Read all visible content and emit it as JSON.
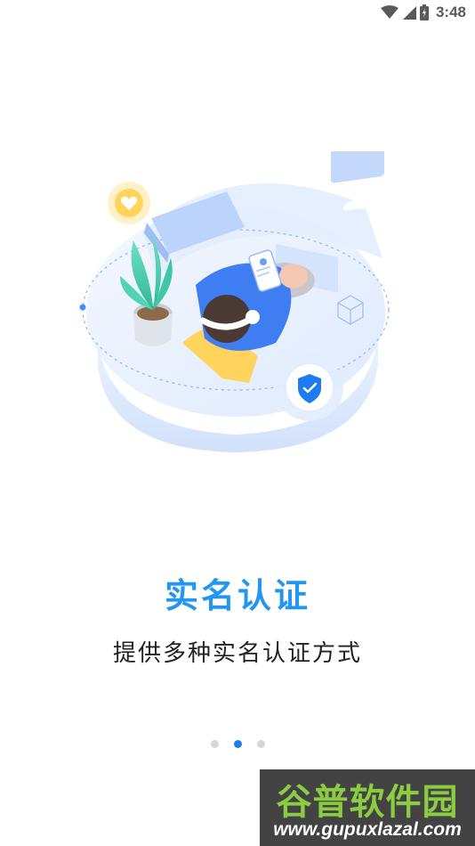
{
  "status_bar": {
    "time": "3:48",
    "icons": [
      "wifi-icon",
      "cell-signal-icon",
      "battery-icon"
    ]
  },
  "onboarding": {
    "illustration": "identity-verification-illustration",
    "title": "实名认证",
    "subtitle": "提供多种实名认证方式",
    "page_indicator": {
      "total": 3,
      "current": 2
    }
  },
  "watermark": {
    "main": "谷普软件园",
    "url": "www.gupuxlazal.com"
  },
  "colors": {
    "accent": "#2196F3",
    "dot_active": "#1e7bf0",
    "dot_inactive": "#d6d6d6",
    "watermark_green": "#7CC52A"
  }
}
